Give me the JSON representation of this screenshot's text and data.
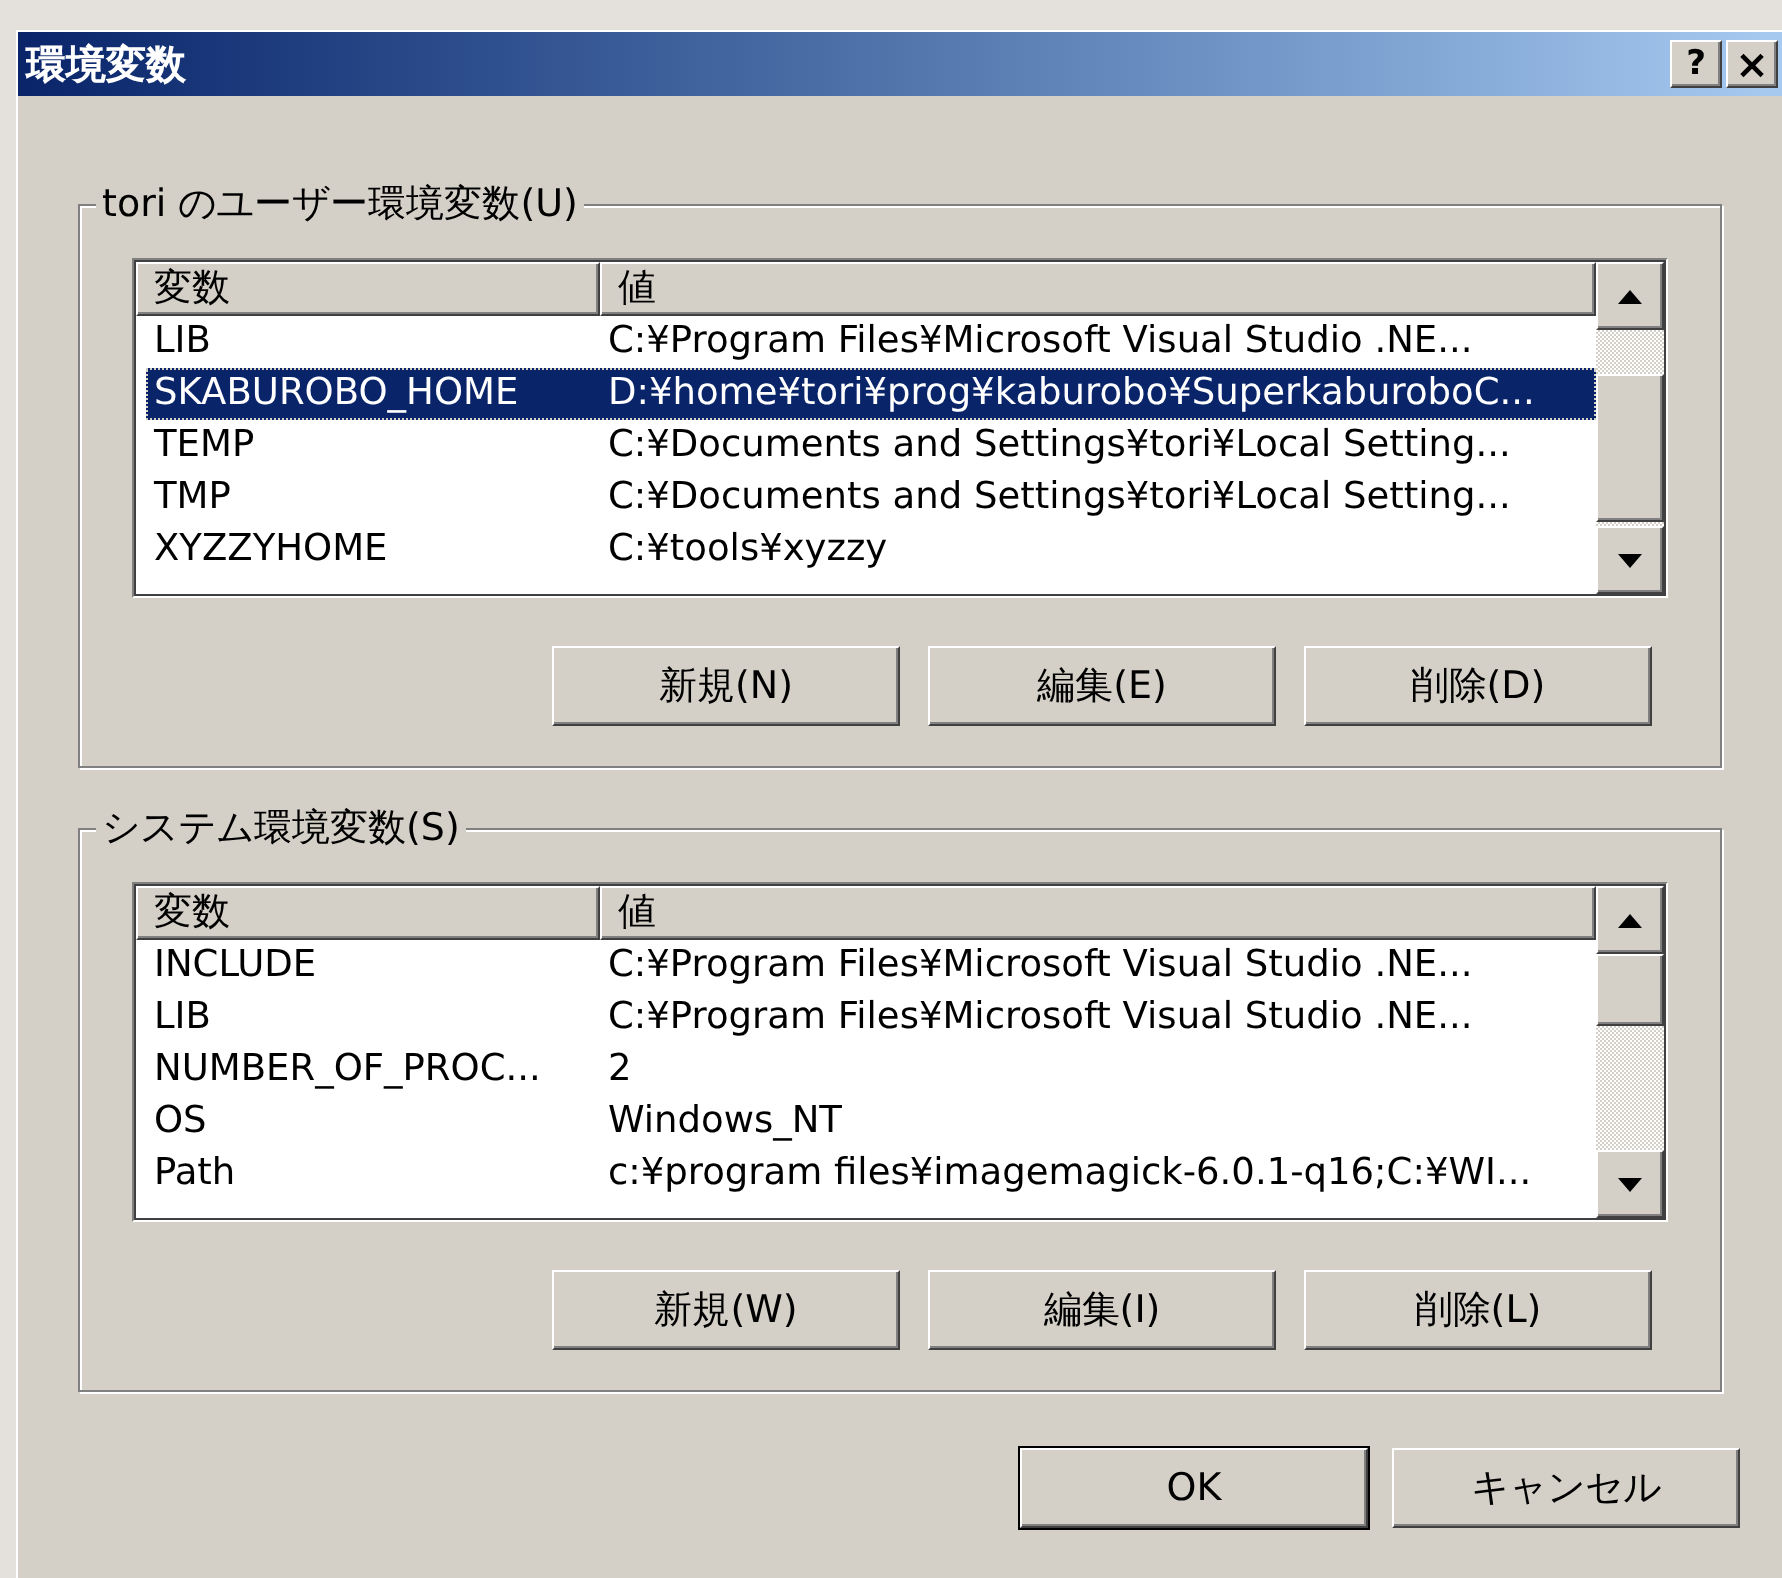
{
  "window": {
    "title": "環境変数",
    "help_button": "?",
    "close_button": "×"
  },
  "user_group": {
    "legend": "tori のユーザー環境変数(U)",
    "columns": [
      "変数",
      "値"
    ],
    "rows": [
      {
        "name": "LIB",
        "value": "C:¥Program Files¥Microsoft Visual Studio .NE...",
        "selected": false
      },
      {
        "name": "SKABUROBO_HOME",
        "value": "D:¥home¥tori¥prog¥kaburobo¥SuperkaburoboC...",
        "selected": true
      },
      {
        "name": "TEMP",
        "value": "C:¥Documents and Settings¥tori¥Local Setting...",
        "selected": false
      },
      {
        "name": "TMP",
        "value": "C:¥Documents and Settings¥tori¥Local Setting...",
        "selected": false
      },
      {
        "name": "XYZZYHOME",
        "value": "C:¥tools¥xyzzy",
        "selected": false
      }
    ],
    "buttons": [
      "新規(N)",
      "編集(E)",
      "削除(D)"
    ]
  },
  "system_group": {
    "legend": "システム環境変数(S)",
    "columns": [
      "変数",
      "値"
    ],
    "rows": [
      {
        "name": "INCLUDE",
        "value": "C:¥Program Files¥Microsoft Visual Studio .NE...",
        "selected": false
      },
      {
        "name": "LIB",
        "value": "C:¥Program Files¥Microsoft Visual Studio .NE...",
        "selected": false
      },
      {
        "name": "NUMBER_OF_PROC...",
        "value": "2",
        "selected": false
      },
      {
        "name": "OS",
        "value": "Windows_NT",
        "selected": false
      },
      {
        "name": "Path",
        "value": "c:¥program files¥imagemagick-6.0.1-q16;C:¥WI...",
        "selected": false
      }
    ],
    "buttons": [
      "新規(W)",
      "編集(I)",
      "削除(L)"
    ]
  },
  "dialog_buttons": [
    {
      "label": "OK",
      "default": true
    },
    {
      "label": "キャンセル",
      "default": false
    }
  ]
}
